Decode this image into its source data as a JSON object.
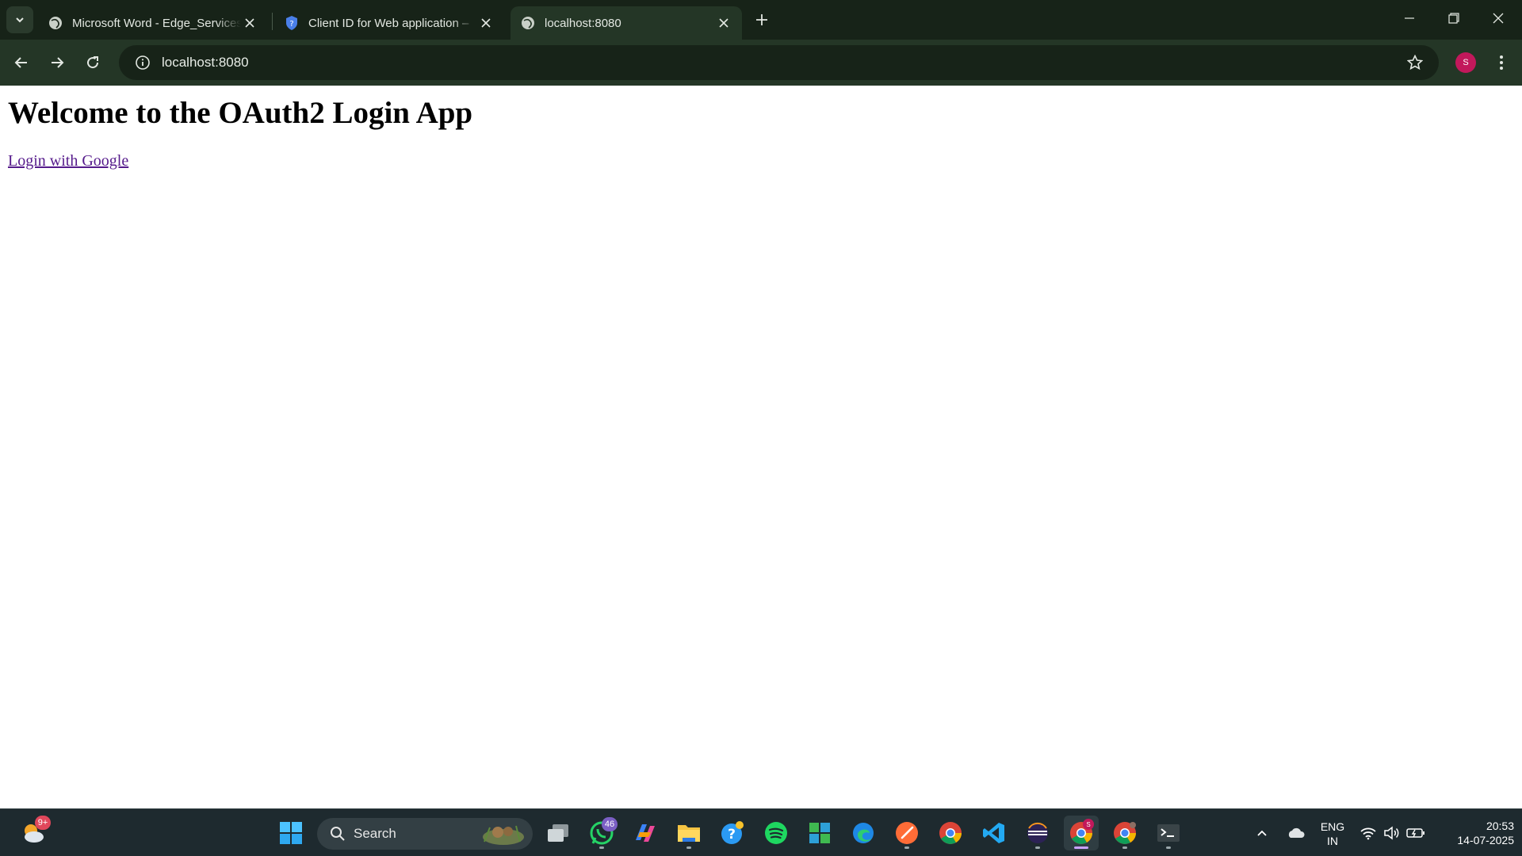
{
  "browser": {
    "tabs": [
      {
        "title": "Microsoft Word - Edge_Services",
        "favicon": "globe-icon",
        "active": false
      },
      {
        "title": "Client ID for Web application –",
        "favicon": "shield-icon",
        "active": false
      },
      {
        "title": "localhost:8080",
        "favicon": "globe-icon",
        "active": true
      }
    ],
    "address": "localhost:8080",
    "profile_initial": "S",
    "colors": {
      "frame": "#172318",
      "toolbar": "#243626",
      "avatar": "#c2185b"
    }
  },
  "page": {
    "heading": "Welcome to the OAuth2 Login App",
    "login_link": "Login with Google"
  },
  "taskbar": {
    "weather_badge": "9+",
    "search_label": "Search",
    "whatsapp_badge": "46",
    "chrome_badge": "S",
    "language": {
      "line1": "ENG",
      "line2": "IN"
    },
    "time": "20:53",
    "date": "14-07-2025"
  }
}
